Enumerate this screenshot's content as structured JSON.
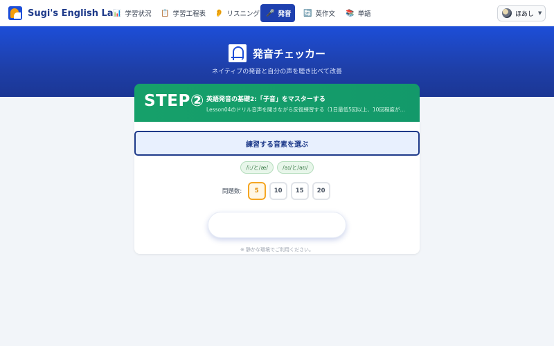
{
  "brand": {
    "name": "Sugi's English Lab",
    "logo_icon": "sugi-logo-icon"
  },
  "nav": {
    "items": [
      {
        "label": "学習状況",
        "icon": "📊",
        "icon_name": "bar-chart-icon",
        "active": false
      },
      {
        "label": "学習工程表",
        "icon": "📋",
        "icon_name": "clipboard-icon",
        "active": false
      },
      {
        "label": "リスニング",
        "icon": "👂",
        "icon_name": "ear-icon",
        "active": false
      },
      {
        "label": "発音",
        "icon": "🎤",
        "icon_name": "microphone-icon",
        "active": true
      },
      {
        "label": "英作文",
        "icon": "🔄",
        "icon_name": "refresh-icon",
        "active": false
      },
      {
        "label": "単語",
        "icon": "📚",
        "icon_name": "books-icon",
        "active": false
      }
    ]
  },
  "user": {
    "name": "ほあし",
    "caret": "▼"
  },
  "hero": {
    "title": "発音チェッカー",
    "subtitle": "ネイティブの発音と自分の声を聴き比べて改善",
    "icon": "speaking-head-icon"
  },
  "step": {
    "label": "STEP②",
    "title": "英語発音の基礎2:「子音」をマスターする",
    "description": "Lesson04のドリル音声を聞きながら反復練習する（1日最低5回以上、10回程度がベ…"
  },
  "practice": {
    "header": "練習する音素を選ぶ",
    "chips": [
      "/iː/と/æ/",
      "/aɪ/と/aʊ/"
    ],
    "count_label": "問題数:",
    "counts": [
      "5",
      "10",
      "15",
      "20"
    ],
    "selected_count": "5",
    "note": "※ 静かな環境でご利用ください。"
  },
  "colors": {
    "nav_active": "#1e40af",
    "hero": "#1d4ed8",
    "step": "#16a06a",
    "accent_selected": "#f5a623"
  }
}
